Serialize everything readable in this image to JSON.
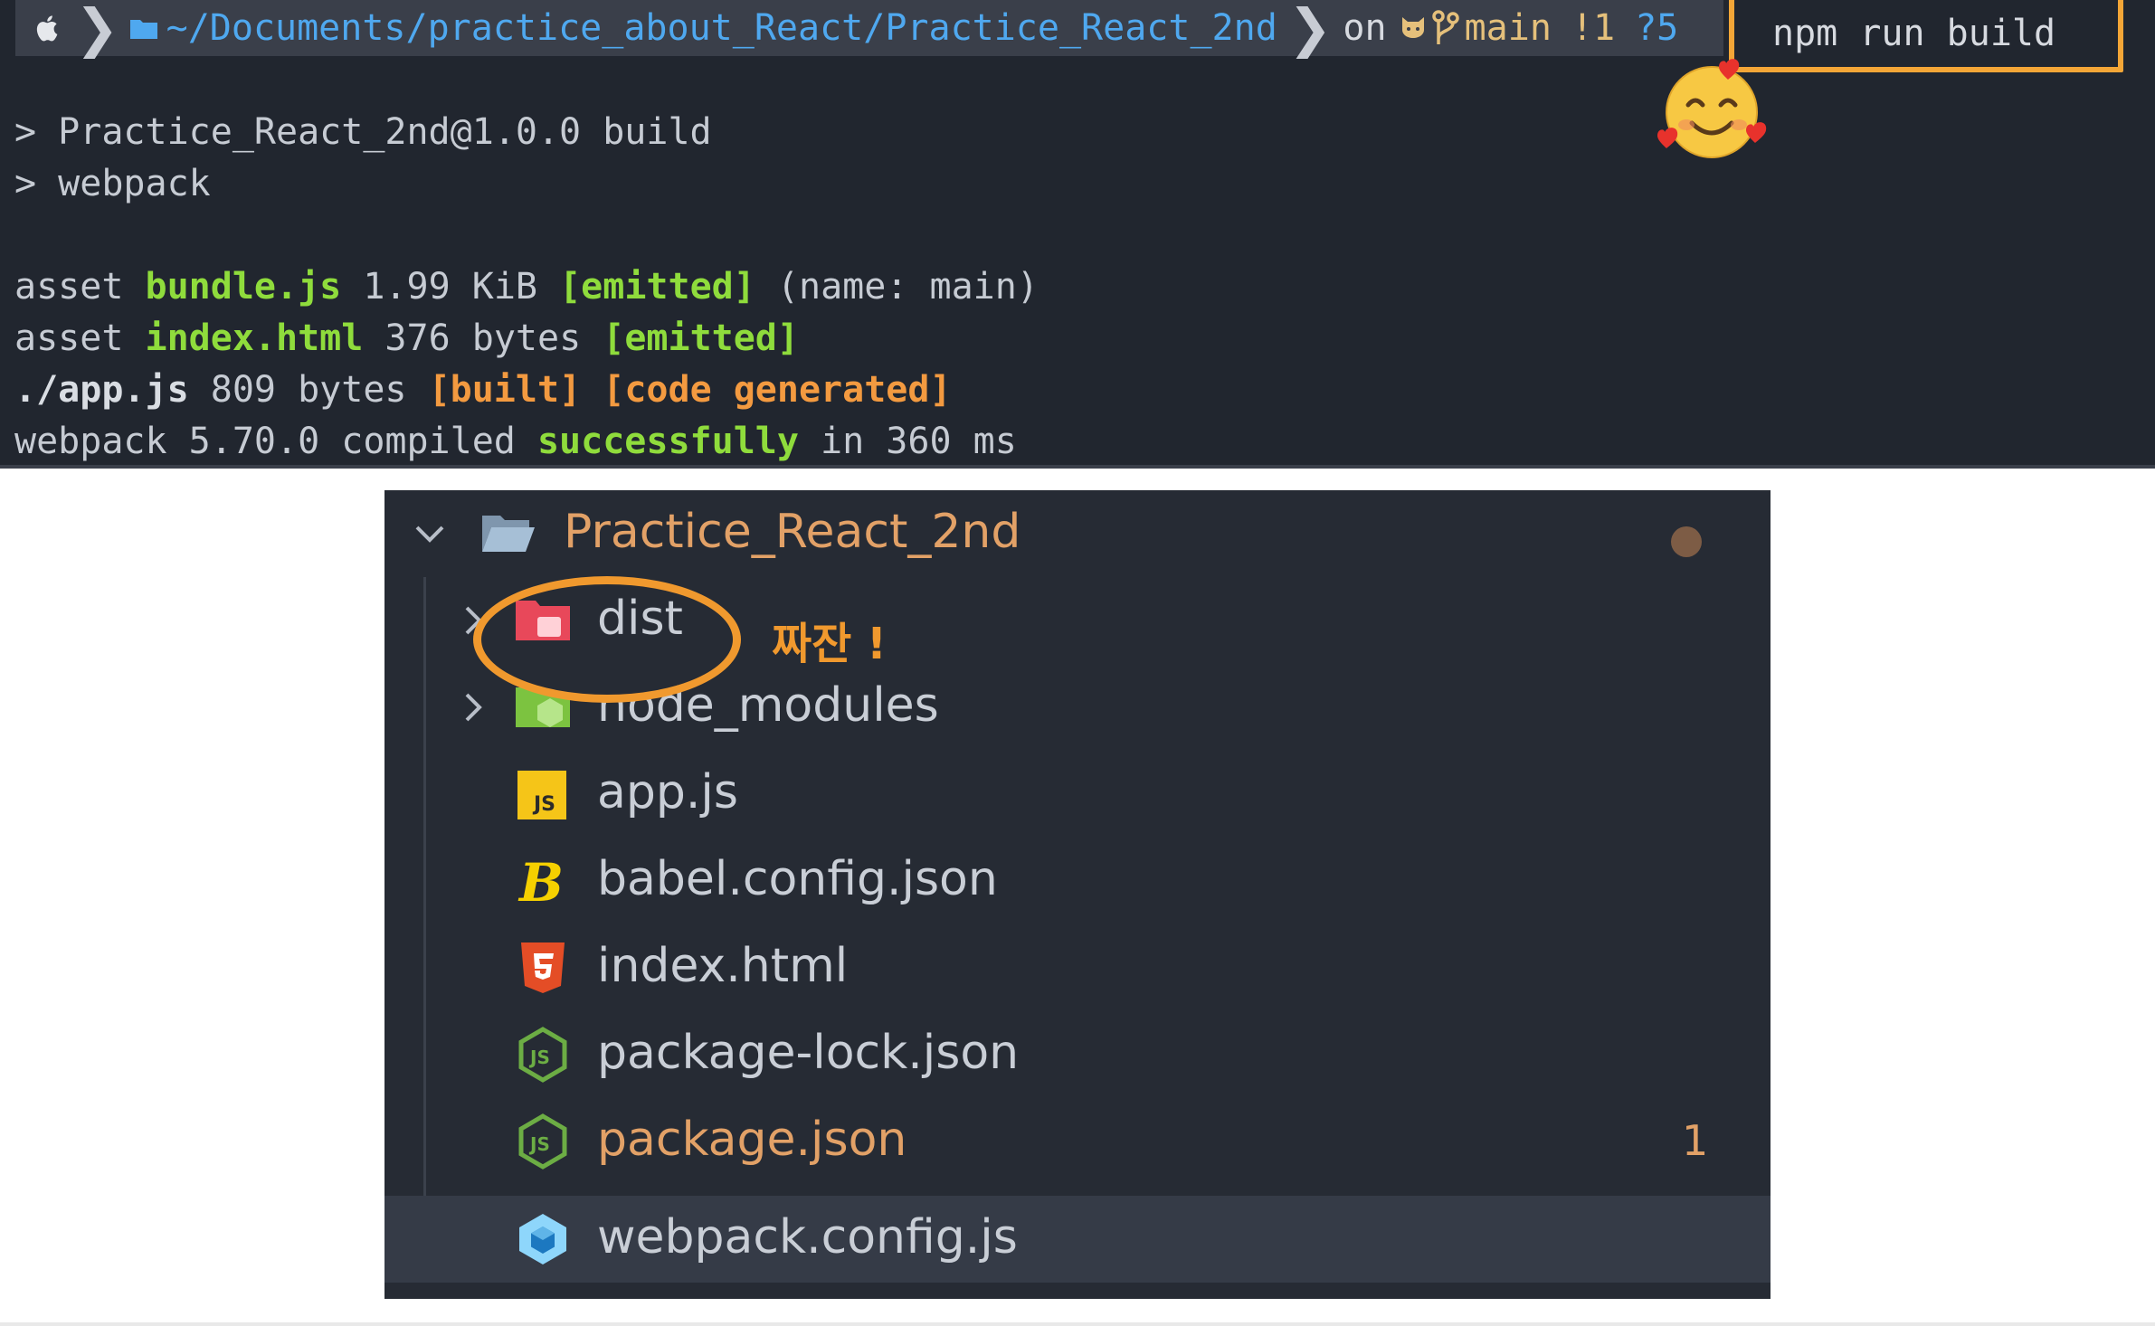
{
  "terminal": {
    "prompt": {
      "path": "~/Documents/practice_about_React/Practice_React_2nd",
      "on": "on",
      "branch": "main",
      "status_modified": "!1",
      "status_untracked": "?5",
      "command": "npm run build"
    },
    "output": {
      "line1": "> Practice_React_2nd@1.0.0 build",
      "line2": "> webpack",
      "asset1": {
        "prefix": "asset ",
        "file": "bundle.js",
        "size": " 1.99 KiB ",
        "tag": "[emitted]",
        "suffix": " (name: main)"
      },
      "asset2": {
        "prefix": "asset ",
        "file": "index.html",
        "size": " 376 bytes ",
        "tag": "[emitted]"
      },
      "module": {
        "file": "./app.js",
        "size": " 809 bytes ",
        "tag1": "[built]",
        "space": " ",
        "tag2": "[code generated]"
      },
      "compiled": {
        "prefix": "webpack 5.70.0 compiled ",
        "status": "successfully",
        "suffix": " in 360 ms"
      }
    }
  },
  "explorer": {
    "root": "Practice_React_2nd",
    "items": [
      {
        "label": "dist",
        "icon": "dist-folder-icon"
      },
      {
        "label": "node_modules",
        "icon": "node-modules-folder-icon"
      },
      {
        "label": "app.js",
        "icon": "javascript-file-icon"
      },
      {
        "label": "babel.config.json",
        "icon": "babel-icon"
      },
      {
        "label": "index.html",
        "icon": "html5-icon"
      },
      {
        "label": "package-lock.json",
        "icon": "nodejs-icon"
      },
      {
        "label": "package.json",
        "icon": "nodejs-icon",
        "badge": "1"
      },
      {
        "label": "webpack.config.js",
        "icon": "webpack-icon"
      }
    ],
    "annotation": "짜잔 !"
  },
  "colors": {
    "terminal_bg": "#21262f",
    "explorer_bg": "#262b34",
    "highlight_orange": "#f4a637",
    "success_green": "#8fdc3c",
    "path_blue": "#4fa8ef"
  }
}
